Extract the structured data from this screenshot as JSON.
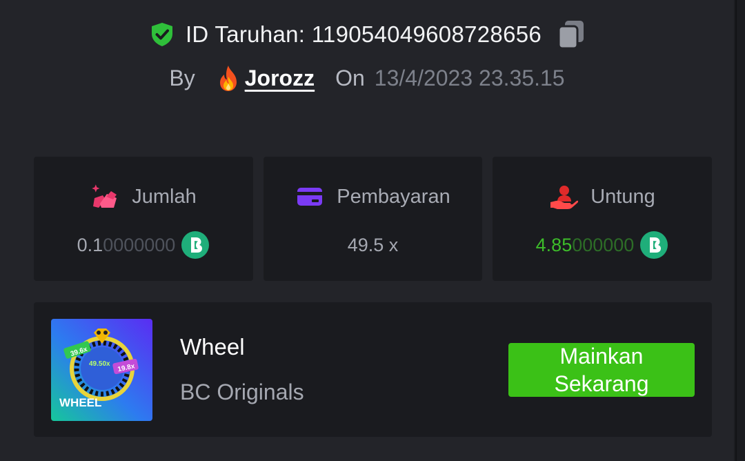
{
  "bet": {
    "id_label": "ID Taruhan: 119054049608728656",
    "by_label": "By",
    "username": "Jorozz",
    "on_label": "On",
    "datetime": "13/4/2023 23.35.15"
  },
  "stats": {
    "amount": {
      "label": "Jumlah",
      "value_main": "0.1",
      "value_dim": "0000000",
      "currency_icon": "bc-coin-icon"
    },
    "payout": {
      "label": "Pembayaran",
      "value": "49.5 x"
    },
    "profit": {
      "label": "Untung",
      "value_main": "4.85",
      "value_dim": "000000",
      "currency_icon": "bc-coin-icon"
    }
  },
  "game": {
    "name": "Wheel",
    "provider": "BC Originals",
    "thumbnail_title": "WHEEL",
    "thumb_multipliers": [
      "39.6x",
      "49.50x",
      "19.8x"
    ],
    "play_button": "Mainkan Sekarang"
  },
  "colors": {
    "background": "#232429",
    "card": "#1a1b1f",
    "accent_green": "#3bc117",
    "profit_green": "#3dbc2a",
    "shield_green": "#2fbf3a",
    "payout_purple": "#7b3bf5",
    "amount_pink": "#e8386b",
    "profit_red": "#e02a2a"
  }
}
